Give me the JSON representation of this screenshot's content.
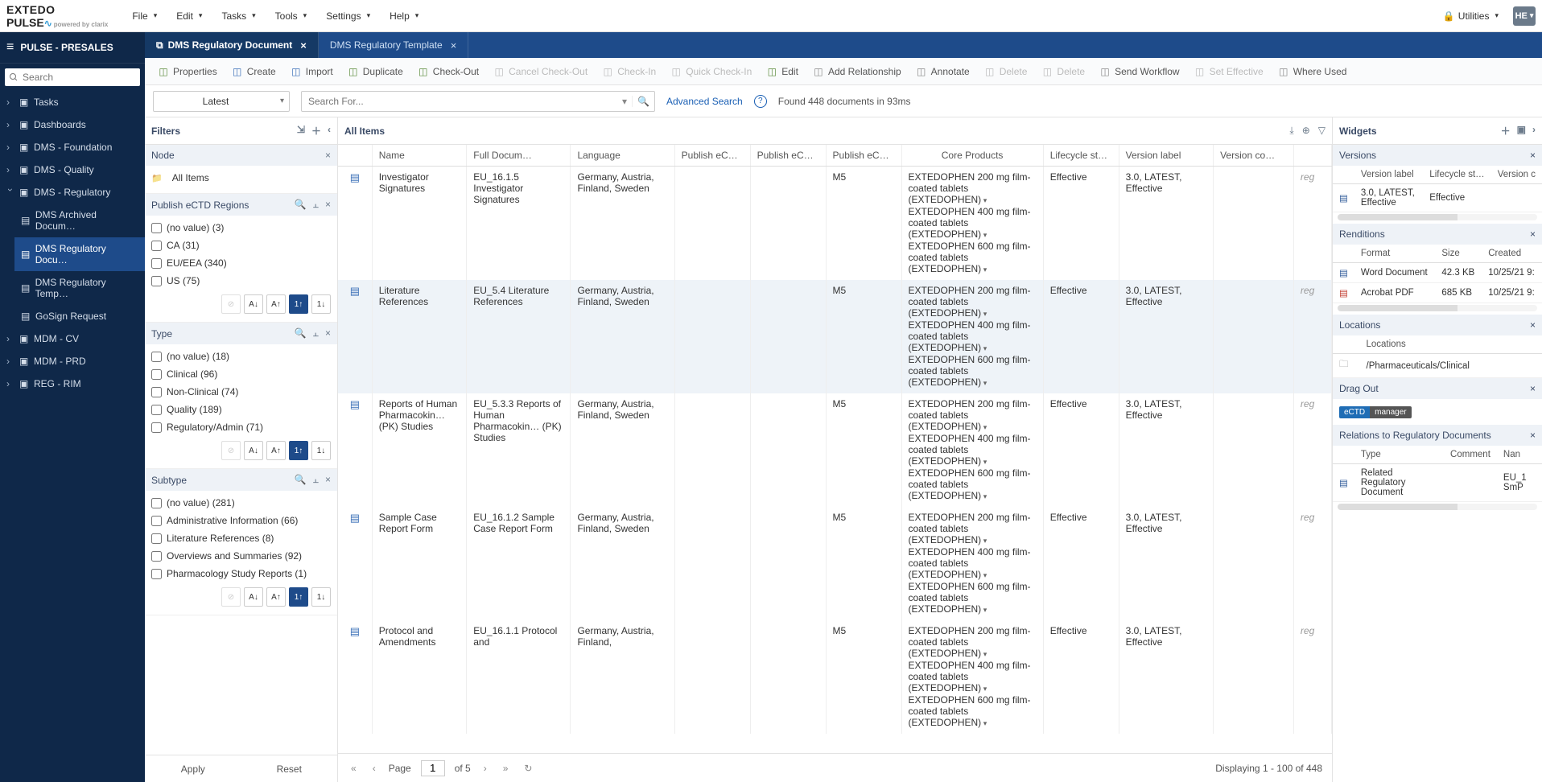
{
  "topbar": {
    "logo": {
      "line1": "EXTEDO",
      "line2": "PULSE",
      "powered": "powered by clarix"
    },
    "menus": [
      "File",
      "Edit",
      "Tasks",
      "Tools",
      "Settings",
      "Help"
    ],
    "utilities": "Utilities",
    "user": "HE"
  },
  "leftnav": {
    "title": "PULSE - PRESALES",
    "search_placeholder": "Search",
    "items": [
      {
        "label": "Tasks"
      },
      {
        "label": "Dashboards"
      },
      {
        "label": "DMS - Foundation"
      },
      {
        "label": "DMS - Quality"
      },
      {
        "label": "DMS - Regulatory",
        "open": true,
        "children": [
          {
            "label": "DMS Archived Docum…"
          },
          {
            "label": "DMS Regulatory Docu…",
            "active": true
          },
          {
            "label": "DMS Regulatory Temp…"
          },
          {
            "label": "GoSign Request"
          }
        ]
      },
      {
        "label": "MDM - CV"
      },
      {
        "label": "MDM - PRD"
      },
      {
        "label": "REG - RIM"
      }
    ]
  },
  "tabs": [
    {
      "label": "DMS Regulatory Document",
      "active": true
    },
    {
      "label": "DMS Regulatory Template",
      "active": false
    }
  ],
  "toolbar": [
    {
      "label": "Properties",
      "icon": "properties",
      "color": "g"
    },
    {
      "label": "Create",
      "icon": "create",
      "color": "b"
    },
    {
      "label": "Import",
      "icon": "import",
      "color": "b"
    },
    {
      "label": "Duplicate",
      "icon": "duplicate",
      "color": "g"
    },
    {
      "label": "Check-Out",
      "icon": "checkout",
      "color": "g"
    },
    {
      "label": "Cancel Check-Out",
      "icon": "cancel",
      "disabled": true
    },
    {
      "label": "Check-In",
      "icon": "checkin",
      "disabled": true
    },
    {
      "label": "Quick Check-In",
      "icon": "quick",
      "disabled": true
    },
    {
      "label": "Edit",
      "icon": "edit",
      "color": "g"
    },
    {
      "label": "Add Relationship",
      "icon": "rel",
      "color": "gray"
    },
    {
      "label": "Annotate",
      "icon": "annotate",
      "color": "gray"
    },
    {
      "label": "Delete",
      "icon": "delete",
      "disabled": true
    },
    {
      "label": "Delete",
      "icon": "delete",
      "disabled": true
    },
    {
      "label": "Send Workflow",
      "icon": "workflow",
      "color": "gray"
    },
    {
      "label": "Set Effective",
      "icon": "effective",
      "disabled": true
    },
    {
      "label": "Where Used",
      "icon": "where",
      "color": "gray"
    }
  ],
  "query": {
    "view": "Latest",
    "search_placeholder": "Search For...",
    "advanced": "Advanced Search",
    "found": "Found 448 documents in 93ms"
  },
  "filters": {
    "title": "Filters",
    "node": {
      "title": "Node",
      "value": "All Items"
    },
    "groups": [
      {
        "title": "Publish eCTD Regions",
        "items": [
          "(no value) (3)",
          "CA (31)",
          "EU/EEA (340)",
          "US (75)"
        ]
      },
      {
        "title": "Type",
        "items": [
          "(no value) (18)",
          "Clinical (96)",
          "Non-Clinical (74)",
          "Quality (189)",
          "Regulatory/Admin (71)"
        ]
      },
      {
        "title": "Subtype",
        "items": [
          "(no value) (281)",
          "Administrative Information (66)",
          "Literature References (8)",
          "Overviews and Summaries (92)",
          "Pharmacology Study Reports (1)"
        ]
      }
    ],
    "apply": "Apply",
    "reset": "Reset"
  },
  "grid": {
    "title": "All Items",
    "columns": [
      "",
      "Name",
      "Full Docum…",
      "Language",
      "Publish eC…",
      "Publish eC…",
      "Publish eC…",
      "Core Products",
      "Lifecycle st…",
      "Version label",
      "Version co…",
      ""
    ],
    "rows": [
      {
        "name": "Investigator Signatures",
        "full": "EU_16.1.5 Investigator Signatures",
        "lang": "Germany, Austria, Finland, Sweden",
        "pub3": "M5",
        "lifecycle": "Effective",
        "ver": "3.0, LATEST, Effective",
        "last": "reg"
      },
      {
        "name": "Literature References",
        "full": "EU_5.4 Literature References",
        "lang": "Germany, Austria, Finland, Sweden",
        "pub3": "M5",
        "lifecycle": "Effective",
        "ver": "3.0, LATEST, Effective",
        "last": "reg",
        "highlight": true
      },
      {
        "name": "Reports of Human Pharmacokin… (PK) Studies",
        "full": "EU_5.3.3 Reports of Human Pharmacokin… (PK) Studies",
        "lang": "Germany, Austria, Finland, Sweden",
        "pub3": "M5",
        "lifecycle": "Effective",
        "ver": "3.0, LATEST, Effective",
        "last": "reg"
      },
      {
        "name": "Sample Case Report Form",
        "full": "EU_16.1.2 Sample Case Report Form",
        "lang": "Germany, Austria, Finland, Sweden",
        "pub3": "M5",
        "lifecycle": "Effective",
        "ver": "3.0, LATEST, Effective",
        "last": "reg"
      },
      {
        "name": "Protocol and Amendments",
        "full": "EU_16.1.1 Protocol and",
        "lang": "Germany, Austria, Finland,",
        "pub3": "M5",
        "lifecycle": "Effective",
        "ver": "3.0, LATEST, Effective",
        "last": "reg"
      }
    ],
    "products": [
      "EXTEDOPHEN 200 mg film-coated tablets (EXTEDOPHEN)",
      "EXTEDOPHEN 400 mg film-coated tablets (EXTEDOPHEN)",
      "EXTEDOPHEN 600 mg film-coated tablets (EXTEDOPHEN)"
    ],
    "footer": {
      "page_label": "Page",
      "page": "1",
      "of": "of 5",
      "display": "Displaying 1 - 100 of 448"
    }
  },
  "widgets": {
    "title": "Widgets",
    "versions": {
      "title": "Versions",
      "cols": [
        "Version label",
        "Lifecycle st…",
        "Version c"
      ],
      "row": {
        "label": "3.0, LATEST, Effective",
        "status": "Effective"
      }
    },
    "renditions": {
      "title": "Renditions",
      "cols": [
        "Format",
        "Size",
        "Created"
      ],
      "rows": [
        {
          "fmt": "Word Document",
          "size": "42.3 KB",
          "created": "10/25/21 9:"
        },
        {
          "fmt": "Acrobat PDF",
          "size": "685 KB",
          "created": "10/25/21 9:"
        }
      ]
    },
    "locations": {
      "title": "Locations",
      "col": "Locations",
      "row": "/Pharmaceuticals/Clinical"
    },
    "dragout": {
      "title": "Drag Out",
      "badge1": "eCTD",
      "badge2": "manager"
    },
    "relations": {
      "title": "Relations to Regulatory Documents",
      "cols": [
        "Type",
        "Comment",
        "Nan"
      ],
      "row": {
        "type": "Related Regulatory Document",
        "nan": "EU_1 SmP"
      }
    }
  }
}
